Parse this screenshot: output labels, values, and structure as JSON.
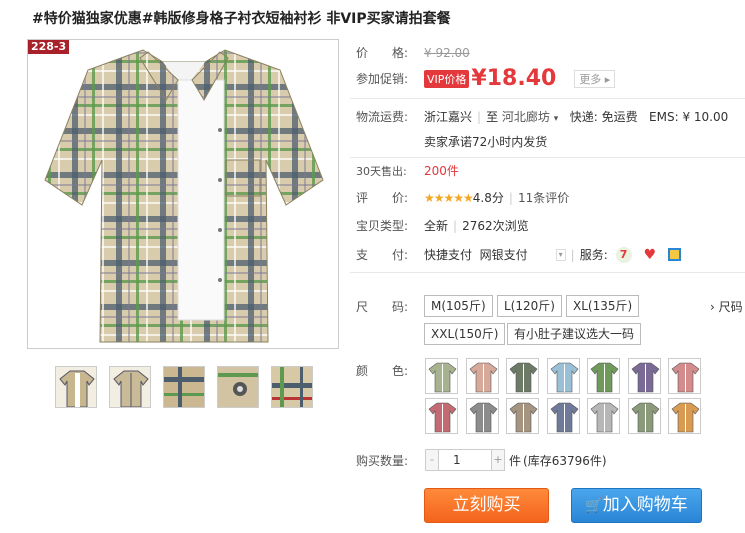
{
  "title": "#特价猫独家优惠#韩版修身格子衬衣短袖衬衫 非VIP买家请拍套餐",
  "image_tag": "228-3",
  "price": {
    "label": "价　　格:",
    "original": "¥ 92.00"
  },
  "promo": {
    "label": "参加促销:",
    "vip_badge": "VIP价格",
    "currency": "¥",
    "value": "18.40",
    "more": "更多 ▸"
  },
  "shipping": {
    "label": "物流运费:",
    "from": "浙江嘉兴",
    "to_prefix": "至",
    "to": "河北廊坊",
    "express": "快递: 免运费",
    "ems": "EMS: ¥ 10.00",
    "promise": "卖家承诺72小时内发货"
  },
  "sales": {
    "label": "30天售出:",
    "count": "200件"
  },
  "rating": {
    "label": "评　　价:",
    "stars": "★★★★★",
    "score": "4.8分",
    "reviews": "11条评价"
  },
  "type": {
    "label": "宝贝类型:",
    "value": "全新",
    "views": "2762次浏览"
  },
  "payment": {
    "label": "支　　付:",
    "quick": "快捷支付",
    "bank": "网银支付",
    "service_label": "服务:"
  },
  "size": {
    "label": "尺　　码:",
    "options": [
      "M(105斤)",
      "L(120斤)",
      "XL(135斤)",
      "XXL(150斤)",
      "有小肚子建议选大一码"
    ],
    "chart_link": "› 尺码"
  },
  "color": {
    "label": "颜　　色:"
  },
  "quantity": {
    "label": "购买数量:",
    "value": "1",
    "unit": "件",
    "stock": "(库存63796件)"
  },
  "buttons": {
    "buy": "立刻购买",
    "cart": "加入购物车"
  },
  "colors": {
    "accent": "#e4393c",
    "buy_button": "#f3641d",
    "cart_button": "#2a85d6"
  }
}
